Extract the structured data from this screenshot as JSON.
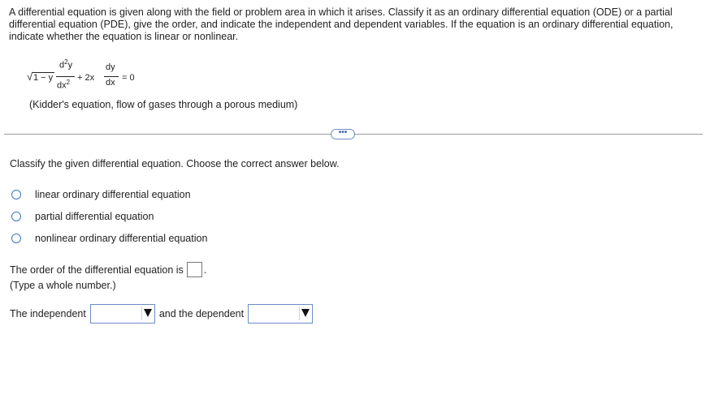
{
  "problem": {
    "intro": "A differential equation is given along with the field or problem area in which it arises. Classify it as an ordinary differential equation (ODE) or a partial differential equation (PDE), give the order, and indicate the independent and dependent variables. If the equation is an ordinary differential equation, indicate whether the equation is linear or nonlinear.",
    "equation": {
      "sqrt_symbol": "√",
      "sqrt_body": "1 − y",
      "num1": "d",
      "num1_exp": "2",
      "num1_tail": "y",
      "den1": "dx",
      "den1_exp": "2",
      "middle": "+ 2x",
      "num2": "dy",
      "den2": "dx",
      "rhs": "= 0"
    },
    "caption": "(Kidder's equation, flow of gases through a porous medium)"
  },
  "expand_button": {
    "label": "•••"
  },
  "question": {
    "instruction": "Classify the given differential equation. Choose the correct answer below.",
    "options": [
      "linear ordinary differential equation",
      "partial differential equation",
      "nonlinear ordinary differential equation"
    ],
    "order_prompt": "The order of the differential equation is",
    "order_suffix": ".",
    "order_hint": "(Type a whole number.)",
    "independent_label": "The independent",
    "dependent_label": "and the dependent"
  }
}
